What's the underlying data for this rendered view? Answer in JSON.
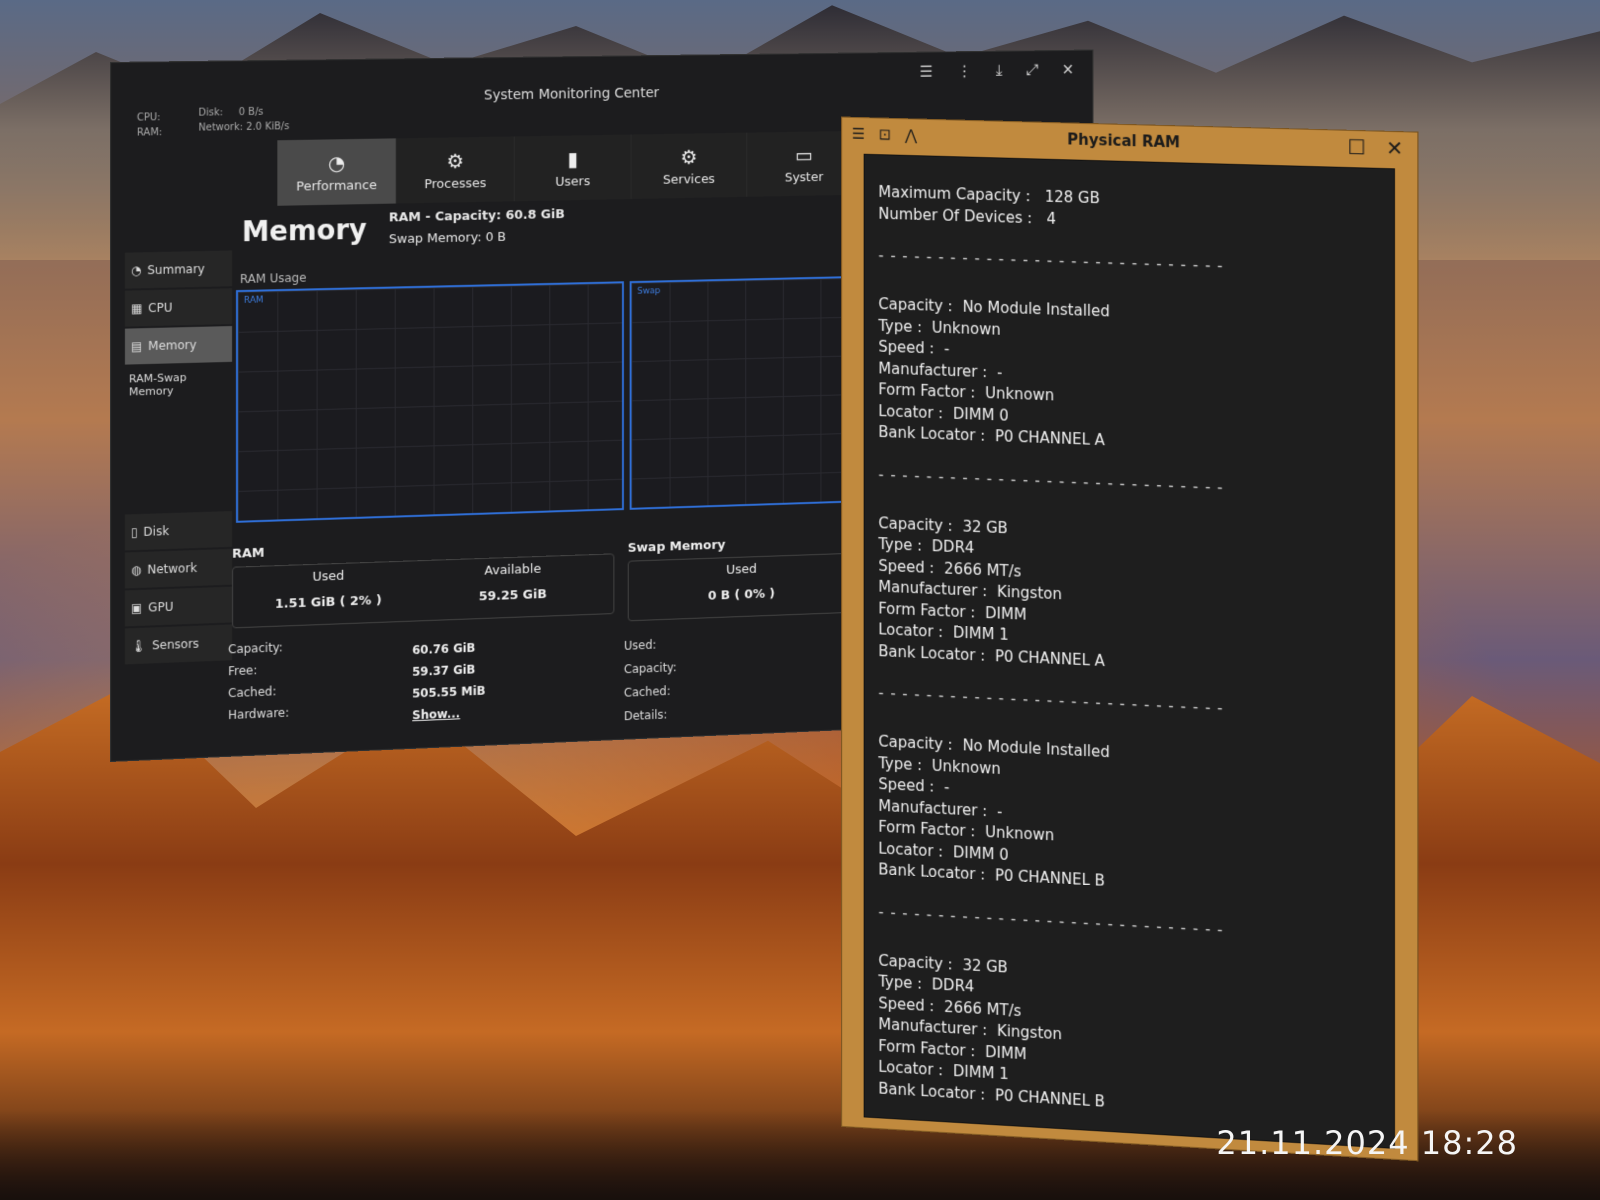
{
  "main_window": {
    "title": "System Monitoring Center",
    "mini": {
      "cpu_label": "CPU:",
      "ram_label": "RAM:",
      "disk_label": "Disk:",
      "disk_value": "0 B/s",
      "network_label": "Network:",
      "network_value": "2.0 KiB/s"
    },
    "tabs": [
      {
        "label": "Performance",
        "icon": "gauge-icon",
        "glyph": "◔"
      },
      {
        "label": "Processes",
        "icon": "gear-icon",
        "glyph": "⚙"
      },
      {
        "label": "Users",
        "icon": "mouse-icon",
        "glyph": "▮"
      },
      {
        "label": "Services",
        "icon": "gears-icon",
        "glyph": "⚙"
      },
      {
        "label": "Syster",
        "icon": "monitor-icon",
        "glyph": "▭"
      }
    ],
    "sidebar": {
      "items": [
        {
          "label": "Summary",
          "icon": "gauge-icon",
          "glyph": "◔"
        },
        {
          "label": "CPU",
          "icon": "cpu-icon",
          "glyph": "▦"
        },
        {
          "label": "Memory",
          "icon": "memory-icon",
          "glyph": "▤"
        }
      ],
      "sub_label": "RAM-Swap Memory",
      "items2": [
        {
          "label": "Disk",
          "icon": "disk-icon",
          "glyph": "▯"
        },
        {
          "label": "Network",
          "icon": "globe-icon",
          "glyph": "◍"
        },
        {
          "label": "GPU",
          "icon": "gpu-icon",
          "glyph": "▣"
        },
        {
          "label": "Sensors",
          "icon": "thermometer-icon",
          "glyph": "🌡"
        }
      ]
    },
    "memory": {
      "title": "Memory",
      "ram_capacity": "RAM - Capacity: 60.8 GiB",
      "swap_memory": "Swap Memory: 0 B",
      "ram_usage_label": "RAM Usage",
      "graph_ram_label": "RAM",
      "graph_swap_label": "Swap",
      "ram_section": "RAM",
      "used_label": "Used",
      "used_value": "1.51 GiB ( 2% )",
      "available_label": "Available",
      "available_value": "59.25 GiB",
      "swap_section": "Swap Memory",
      "swap_used_label": "Used",
      "swap_used_value": "0 B ( 0% )",
      "details": [
        {
          "k": "Capacity:",
          "v": "60.76 GiB"
        },
        {
          "k": "Free:",
          "v": "59.37 GiB"
        },
        {
          "k": "Cached:",
          "v": "505.55 MiB"
        },
        {
          "k": "Hardware:",
          "v": "Show..."
        }
      ],
      "swap_details": [
        "Used:",
        "Capacity:",
        "Cached:",
        "Details:"
      ]
    }
  },
  "ram_window": {
    "title": "Physical RAM",
    "max_capacity_label": "Maximum Capacity :",
    "max_capacity_value": "128 GB",
    "num_devices_label": "Number Of Devices :",
    "num_devices_value": "4",
    "separator": "- - - - - - - - - - - - - - - - - - - - - - - - - - - - -",
    "modules": [
      {
        "capacity": "No Module Installed",
        "type": "Unknown",
        "speed": "-",
        "manufacturer": "-",
        "form_factor": "Unknown",
        "locator": "DIMM 0",
        "bank_locator": "P0 CHANNEL A"
      },
      {
        "capacity": "32 GB",
        "type": "DDR4",
        "speed": "2666 MT/s",
        "manufacturer": "Kingston",
        "form_factor": "DIMM",
        "locator": "DIMM 1",
        "bank_locator": "P0 CHANNEL A"
      },
      {
        "capacity": "No Module Installed",
        "type": "Unknown",
        "speed": "-",
        "manufacturer": "-",
        "form_factor": "Unknown",
        "locator": "DIMM 0",
        "bank_locator": "P0 CHANNEL B"
      },
      {
        "capacity": "32 GB",
        "type": "DDR4",
        "speed": "2666 MT/s",
        "manufacturer": "Kingston",
        "form_factor": "DIMM",
        "locator": "DIMM 1",
        "bank_locator": "P0 CHANNEL B"
      }
    ],
    "labels": {
      "capacity": "Capacity :",
      "type": "Type :",
      "speed": "Speed :",
      "manufacturer": "Manufacturer :",
      "form_factor": "Form Factor :",
      "locator": "Locator :",
      "bank_locator": "Bank Locator :"
    }
  },
  "photo_timestamp": "21.11.2024 18:28",
  "colors": {
    "graph_border": "#2f6fd8",
    "ram_window_frame": "#c18a3e"
  }
}
